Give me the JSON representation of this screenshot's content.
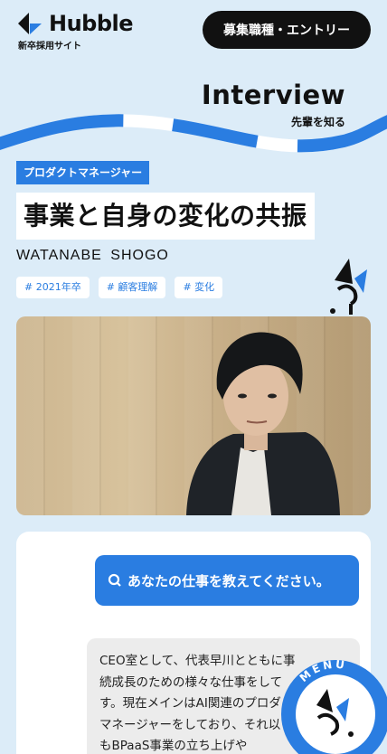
{
  "header": {
    "logo_text": "Hubble",
    "logo_sub": "新卒採用サイト",
    "entry_label": "募集職種・エントリー"
  },
  "hero": {
    "title": "Interview",
    "subtitle": "先輩を知る"
  },
  "article": {
    "category": "プロダクトマネージャー",
    "title": "事業と自身の変化の共振",
    "person_name": "WATANABE  SHOGO",
    "tags": [
      "# 2021年卒",
      "# 顧客理解",
      "# 変化"
    ]
  },
  "qa": {
    "question": "あなたの仕事を教えてください。",
    "answer_lines": [
      "CEO室として、代表早川とともに事",
      "続成長のための様々な仕事をして",
      "す。現在メインはAI関連のプロダ",
      "マネージャーをしており、それ以",
      "もBPaaS事業の立ち上げや"
    ]
  },
  "menu": {
    "label": "MENU"
  },
  "colors": {
    "accent": "#2a7de1",
    "background": "#dcecf8",
    "dark": "#111111"
  }
}
